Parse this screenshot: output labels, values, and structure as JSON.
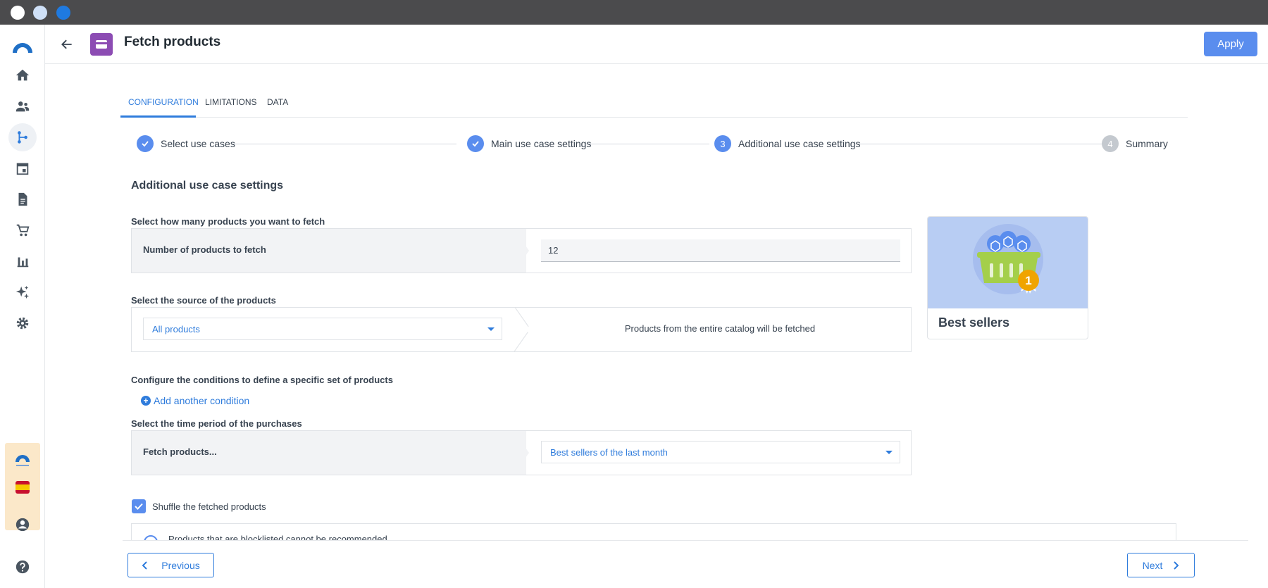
{
  "header": {
    "title": "Fetch products",
    "apply_label": "Apply"
  },
  "tabs": [
    {
      "label": "CONFIGURATION",
      "active": true
    },
    {
      "label": "LIMITATIONS",
      "active": false
    },
    {
      "label": "DATA",
      "active": false
    }
  ],
  "steps": [
    {
      "number": "",
      "label": "Select use cases",
      "state": "done"
    },
    {
      "number": "",
      "label": "Main use case settings",
      "state": "done"
    },
    {
      "number": "3",
      "label": "Additional use case settings",
      "state": "current"
    },
    {
      "number": "4",
      "label": "Summary",
      "state": "pending"
    }
  ],
  "section": {
    "title": "Additional use case settings"
  },
  "quantity": {
    "label": "Select how many products you want to fetch",
    "field_label": "Number of products to fetch",
    "value": "12"
  },
  "source": {
    "label": "Select the source of the products",
    "selected": "All products",
    "description": "Products from the entire catalog will be fetched"
  },
  "conditions": {
    "label": "Configure the conditions to define a specific set of products",
    "add_label": "Add another condition"
  },
  "period": {
    "label": "Select the time period of the purchases",
    "field_label": "Fetch products...",
    "selected": "Best sellers of the last month"
  },
  "shuffle": {
    "label": "Shuffle the fetched products",
    "checked": true
  },
  "info": {
    "text": "Products that are blocklisted cannot be recommended"
  },
  "card": {
    "title": "Best sellers",
    "badge": "1"
  },
  "footer": {
    "previous_label": "Previous",
    "next_label": "Next"
  },
  "colors": {
    "accent": "#5a8dee",
    "link": "#2f7cdc",
    "function_icon": "#8c4cb3",
    "badge_bg": "#fbe8c9"
  },
  "sidebar": {
    "items": [
      {
        "icon": "home-icon"
      },
      {
        "icon": "people-icon"
      },
      {
        "icon": "workflow-icon",
        "active": true
      },
      {
        "icon": "calendar-icon"
      },
      {
        "icon": "document-icon"
      },
      {
        "icon": "cart-icon"
      },
      {
        "icon": "bar-chart-icon"
      },
      {
        "icon": "sparkle-icon"
      },
      {
        "icon": "gear-icon"
      }
    ]
  }
}
